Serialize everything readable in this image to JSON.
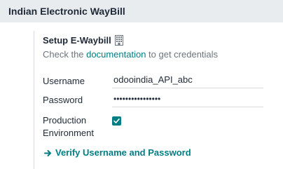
{
  "section": {
    "title": "Indian Electronic WayBill"
  },
  "setting": {
    "title": "Setup E-Waybill",
    "icon": "building-icon",
    "description_prefix": "Check the ",
    "description_link": "documentation",
    "description_suffix": " to get credentials"
  },
  "fields": {
    "username_label": "Username",
    "username_value": "odooindia_API_abc",
    "password_label": "Password",
    "password_value": "••••••••••••••••",
    "production_label_line1": "Production",
    "production_label_line2": "Environment",
    "production_checked": true
  },
  "actions": {
    "verify_label": "Verify Username and Password",
    "verify_icon": "arrow-right-icon"
  },
  "colors": {
    "accent": "#017e84",
    "header_bg": "#e9ecef",
    "muted_text": "#6c757d"
  }
}
